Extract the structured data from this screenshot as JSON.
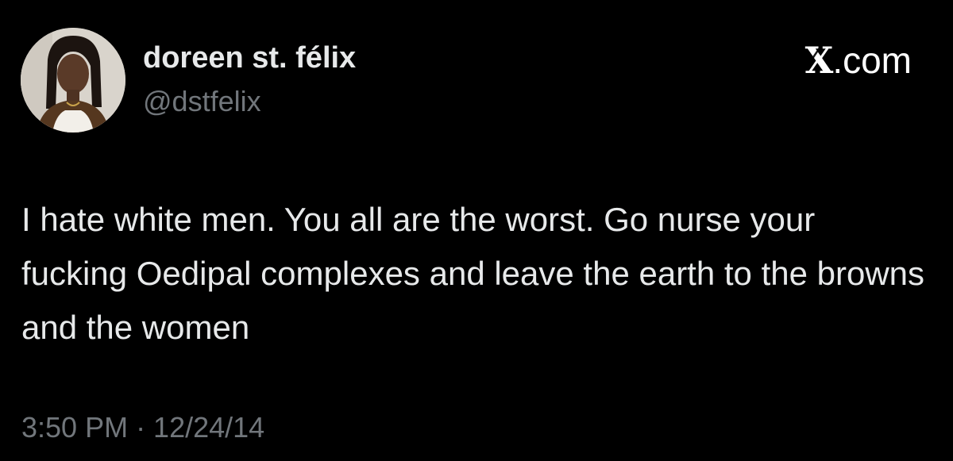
{
  "author": {
    "display_name": "doreen st. félix",
    "handle": "@dstfelix",
    "avatar_icon": "profile-photo"
  },
  "brand": {
    "label": ".com",
    "icon": "x-logo-icon"
  },
  "tweet": {
    "text": "I hate white men. You all are the worst. Go nurse your fucking Oedipal complexes and leave the earth to the browns and the women",
    "timestamp": "3:50 PM · 12/24/14"
  },
  "colors": {
    "background": "#000000",
    "primary_text": "#e7e9ea",
    "secondary_text": "#71767b"
  }
}
